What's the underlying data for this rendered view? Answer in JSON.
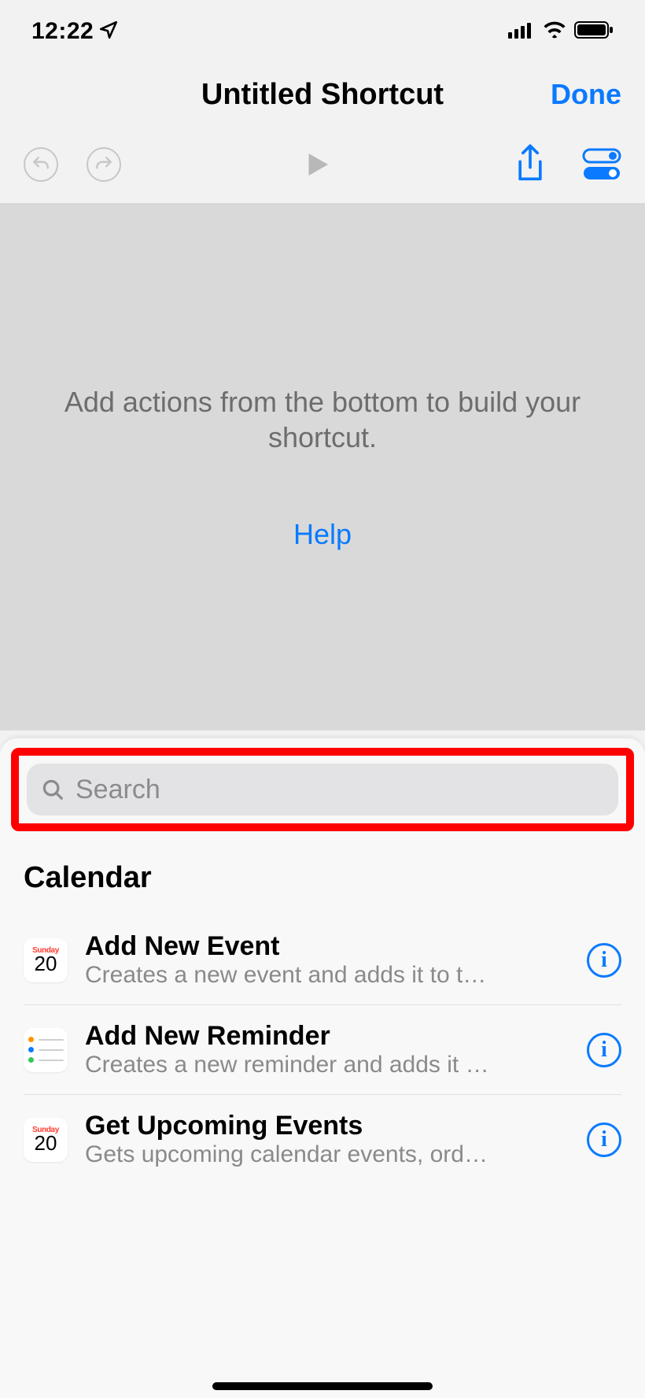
{
  "status": {
    "time": "12:22"
  },
  "nav": {
    "title": "Untitled Shortcut",
    "done": "Done"
  },
  "canvas": {
    "hint": "Add actions from the bottom to build your shortcut.",
    "help": "Help"
  },
  "search": {
    "placeholder": "Search"
  },
  "section": {
    "header": "Calendar",
    "rows": [
      {
        "icon": "calendar",
        "cal_day": "Sunday",
        "cal_num": "20",
        "title": "Add New Event",
        "subtitle": "Creates a new event and adds it to the sel…"
      },
      {
        "icon": "reminders",
        "title": "Add New Reminder",
        "subtitle": "Creates a new reminder and adds it to the…"
      },
      {
        "icon": "calendar",
        "cal_day": "Sunday",
        "cal_num": "20",
        "title": "Get Upcoming Events",
        "subtitle": "Gets upcoming calendar events, ordered fr…"
      }
    ]
  }
}
